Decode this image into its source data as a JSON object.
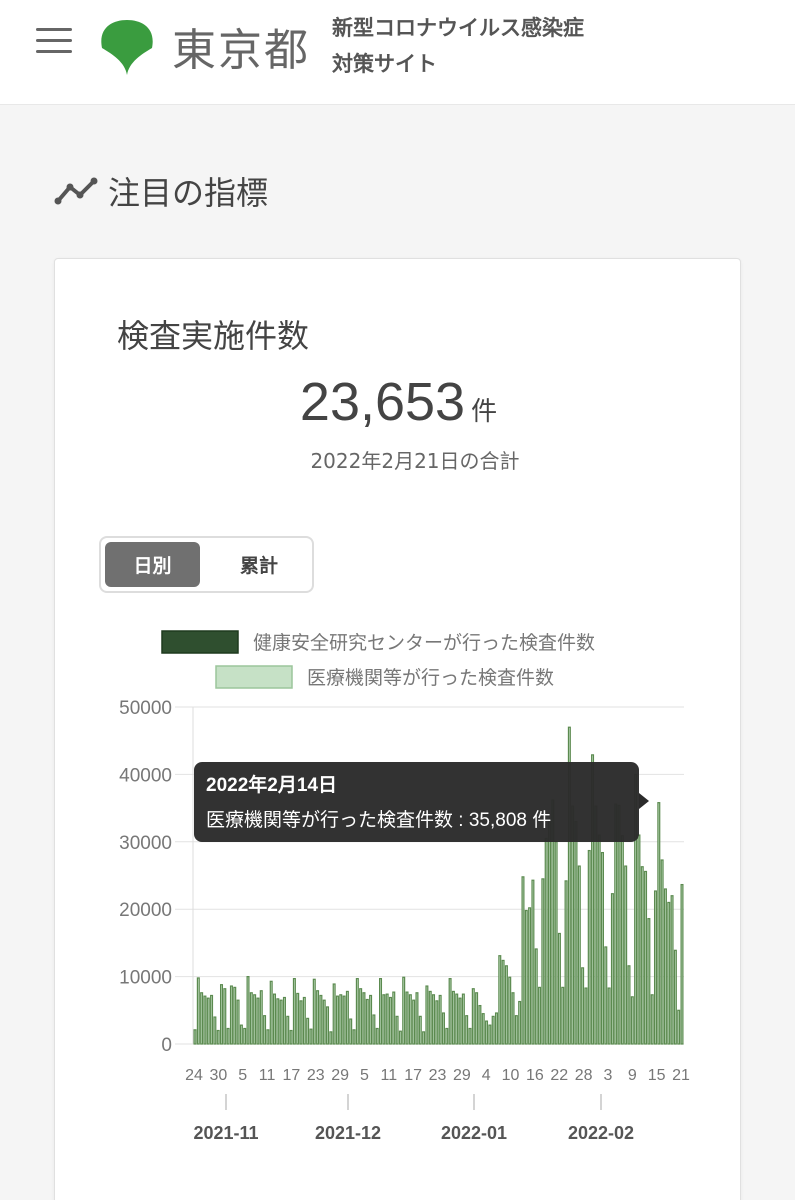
{
  "header": {
    "logo_text": "東京都",
    "site_title_line1": "新型コロナウイルス感染症",
    "site_title_line2": "対策サイト"
  },
  "section": {
    "title": "注目の指標"
  },
  "card": {
    "title": "検査実施件数",
    "total": "23,653",
    "unit": "件",
    "date_note": "2022年2月21日の合計",
    "toggle": {
      "daily": "日別",
      "cumulative": "累計"
    }
  },
  "tooltip": {
    "title": "2022年2月14日",
    "body": "医療機関等が行った検査件数 : 35,808 件"
  },
  "colors": {
    "accent": "#00a040",
    "dark_series": "#2f4f2f",
    "light_series": "#c6e1c6",
    "bar_stroke": "#5b8a4f"
  },
  "chart_data": {
    "type": "bar",
    "stacked": true,
    "legend": [
      "健康安全研究センターが行った検査件数",
      "医療機関等が行った検査件数"
    ],
    "ylim": [
      0,
      50000
    ],
    "yticks": [
      "50000",
      "40000",
      "30000",
      "20000",
      "10000",
      "0"
    ],
    "xtick_labels": [
      "24",
      "30",
      "5",
      "11",
      "17",
      "23",
      "29",
      "5",
      "11",
      "17",
      "23",
      "29",
      "4",
      "10",
      "16",
      "22",
      "28",
      "3",
      "9",
      "15",
      "21"
    ],
    "month_labels": [
      "2021-11",
      "2021-12",
      "2022-01",
      "2022-02"
    ],
    "series": [
      {
        "name": "健康安全研究センターが行った検査件数",
        "values": [
          0,
          0,
          0,
          0,
          0,
          0,
          0,
          0,
          0,
          0,
          0,
          0,
          0,
          0,
          0,
          0,
          0,
          0,
          0,
          0,
          0,
          0,
          0,
          0,
          0,
          0,
          0,
          0,
          0,
          0,
          0,
          0,
          0,
          0,
          0,
          0,
          0,
          0,
          0,
          0,
          0,
          0,
          0,
          0,
          0,
          0,
          0,
          0,
          0,
          0,
          0,
          0,
          0,
          0,
          0,
          0,
          0,
          0,
          0,
          0,
          0,
          0,
          0,
          0,
          0,
          0,
          0,
          0,
          0,
          0,
          0,
          0,
          0,
          0,
          0,
          0,
          0,
          0,
          0,
          0,
          0,
          0,
          0,
          0,
          0,
          0,
          0,
          0,
          0,
          0,
          0,
          0,
          0,
          0,
          0,
          0,
          0,
          0,
          0,
          0,
          0,
          0,
          0,
          0,
          0,
          0,
          0,
          0,
          0,
          0,
          0,
          0,
          0,
          0,
          0,
          0,
          0,
          0,
          0,
          0,
          0,
          0,
          0,
          0,
          0,
          0,
          0,
          0,
          0,
          0,
          0,
          0,
          0,
          0,
          0,
          0,
          0,
          0,
          0,
          0,
          0,
          0,
          0,
          0,
          0,
          0,
          0,
          0,
          0,
          0,
          0,
          0,
          0
        ]
      },
      {
        "name": "医療機関等が行った検査件数",
        "values": [
          2100,
          9800,
          7600,
          7100,
          6800,
          7200,
          4000,
          2000,
          8800,
          8200,
          2300,
          8600,
          8400,
          6500,
          2800,
          2300,
          10000,
          7600,
          7300,
          6800,
          7900,
          4200,
          2100,
          9300,
          7400,
          6700,
          6500,
          6900,
          4100,
          2000,
          9700,
          7500,
          6400,
          6900,
          3800,
          2200,
          9600,
          7900,
          7200,
          6500,
          5500,
          1800,
          8900,
          7100,
          7300,
          7100,
          7800,
          3700,
          2100,
          9700,
          8200,
          7600,
          6600,
          7200,
          4300,
          2300,
          9700,
          7300,
          7400,
          6900,
          7700,
          4100,
          1900,
          9900,
          7700,
          7300,
          6500,
          7600,
          4100,
          1800,
          8600,
          7800,
          7300,
          6400,
          7200,
          4600,
          2300,
          9700,
          7800,
          7400,
          6800,
          7400,
          4200,
          2300,
          8200,
          7600,
          5700,
          4500,
          3400,
          2800,
          4100,
          4600,
          13100,
          12400,
          11600,
          9900,
          7600,
          4200,
          6300,
          24800,
          19800,
          20200,
          24300,
          14100,
          8400,
          24500,
          30500,
          33100,
          36200,
          30000,
          16400,
          8400,
          24200,
          47000,
          35300,
          33000,
          26400,
          11300,
          8300,
          28700,
          42900,
          35300,
          31000,
          28400,
          14400,
          8300,
          22300,
          35600,
          35400,
          30900,
          26400,
          11600,
          7000,
          40000,
          31000,
          26300,
          25600,
          18600,
          7300,
          22700,
          35808,
          27300,
          23000,
          21000,
          22000,
          13900,
          5000,
          23653
        ]
      }
    ]
  }
}
